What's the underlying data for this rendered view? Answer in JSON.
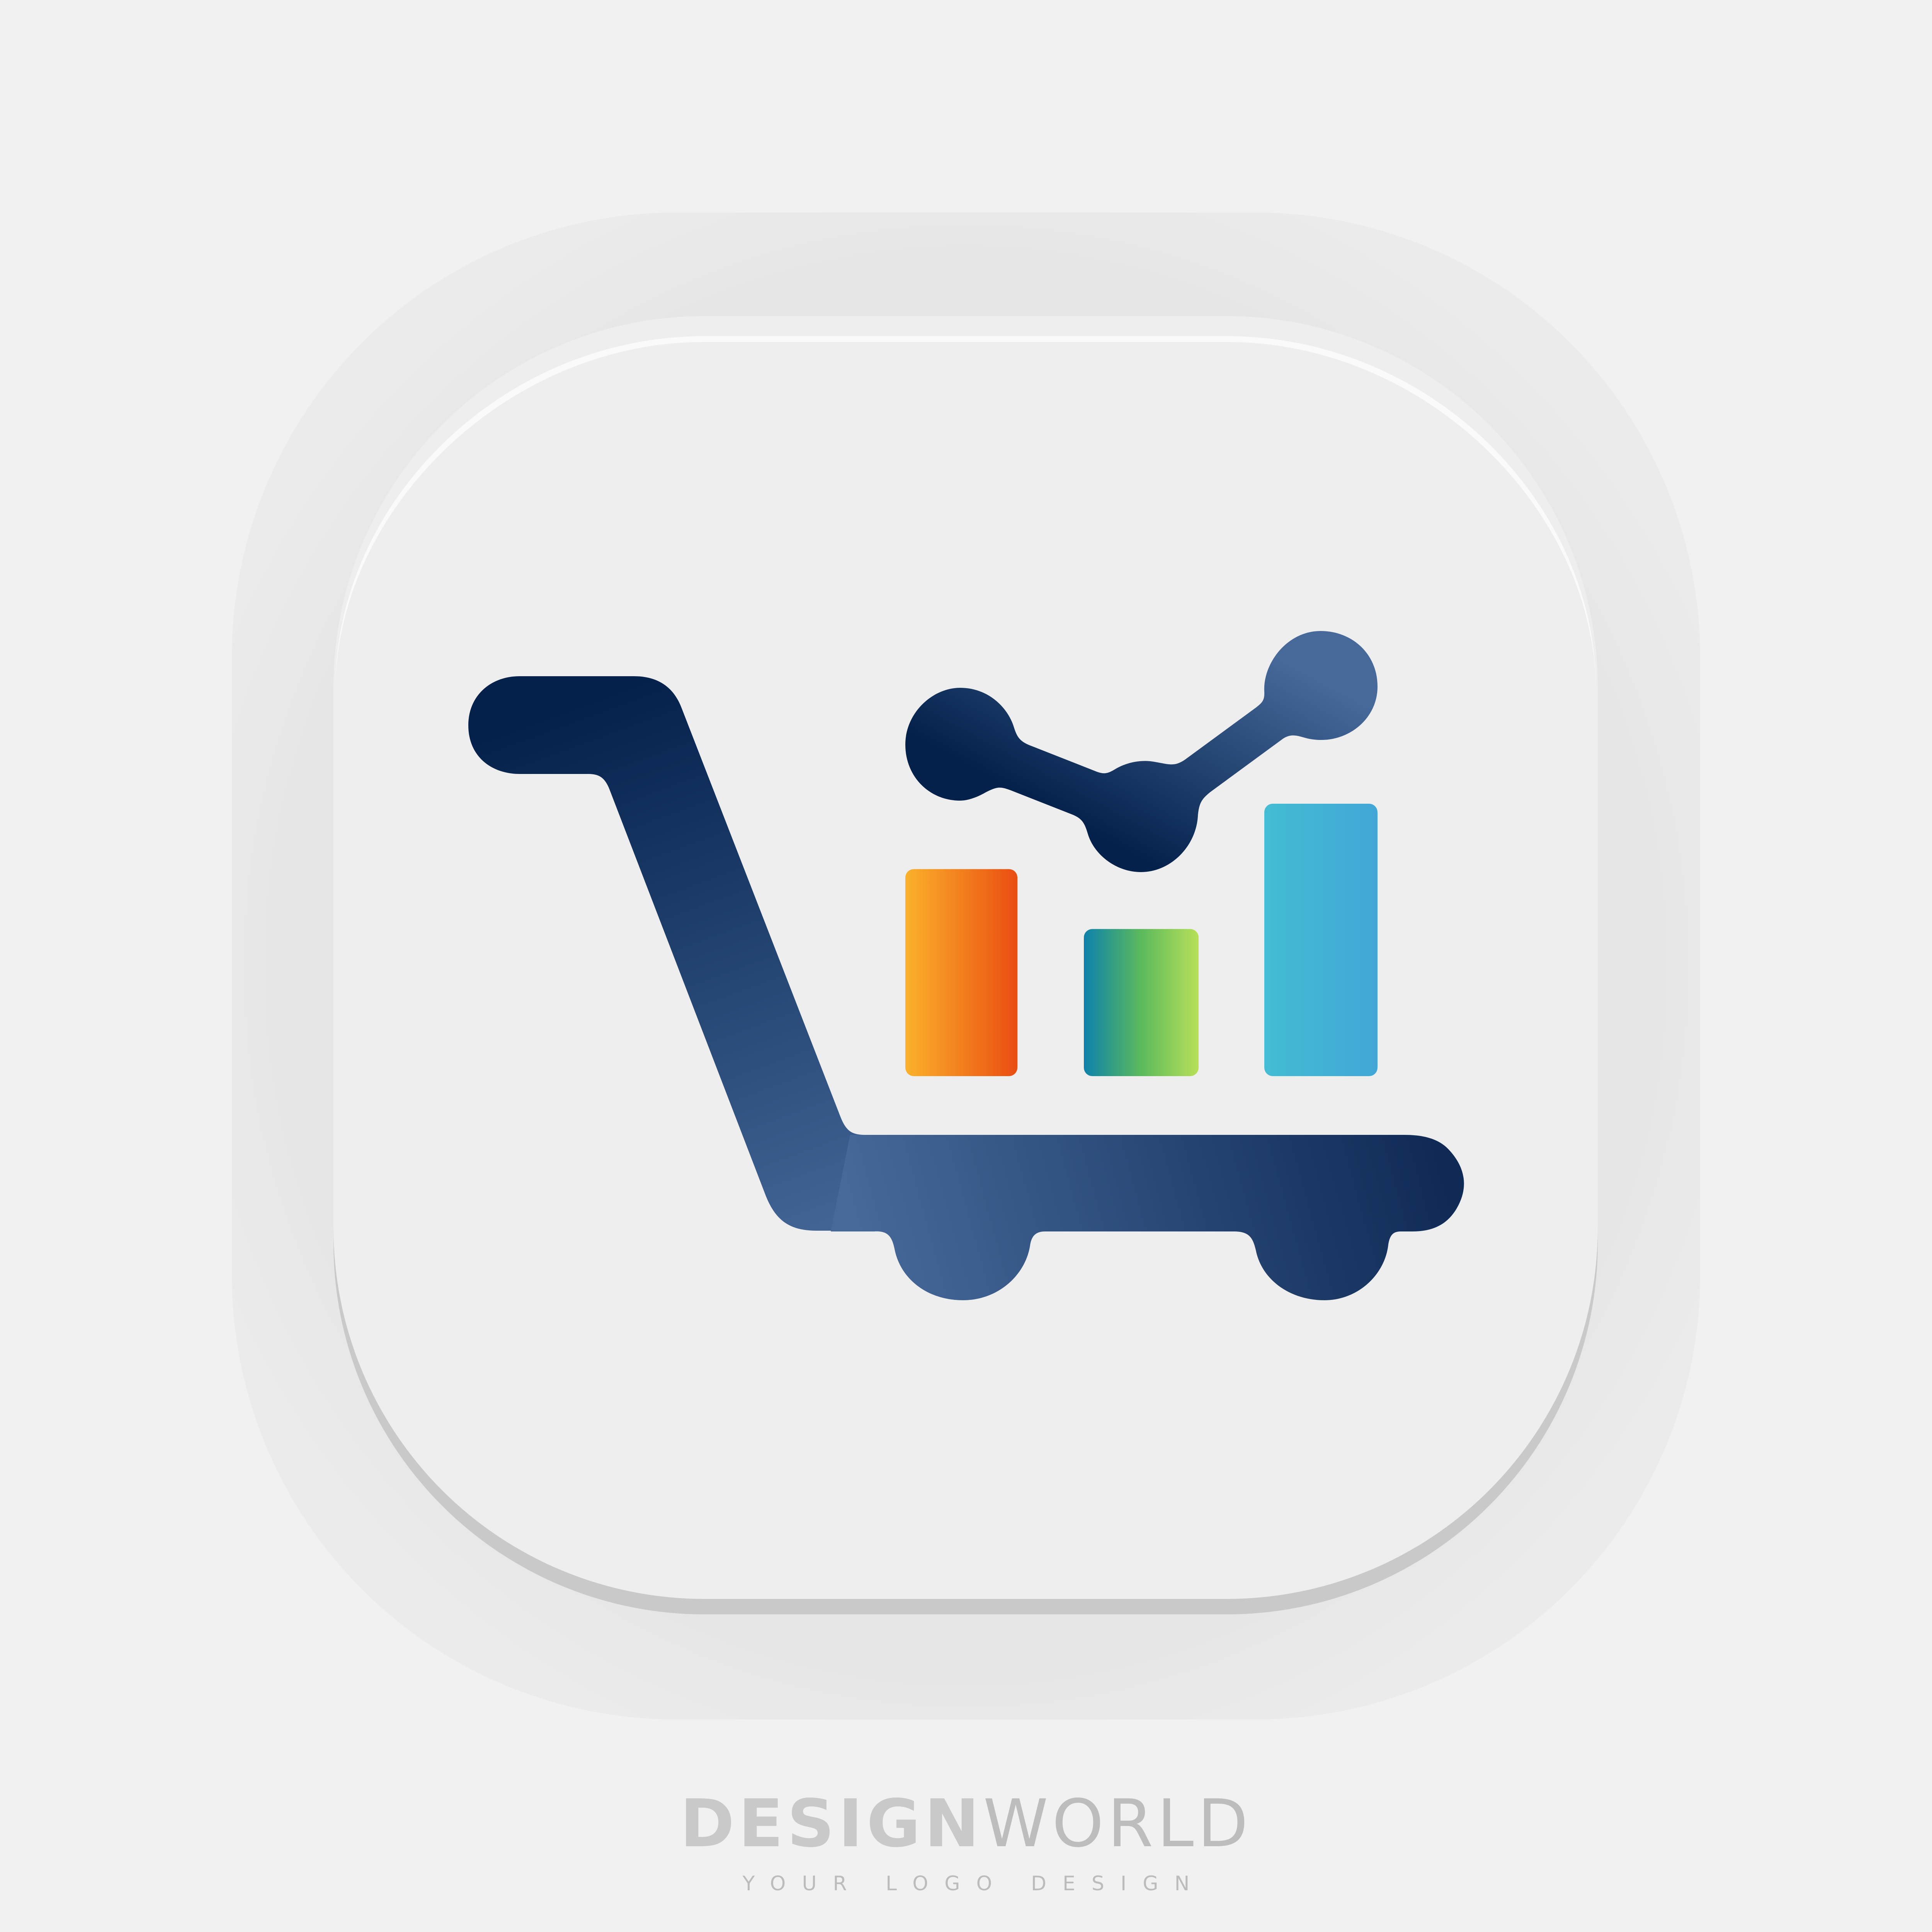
{
  "brand": {
    "name_bold": "DESIGN",
    "name_light": "WORLD",
    "tagline": "YOUR LOGO DESIGN"
  },
  "icon": {
    "name": "shopping-cart-growth-chart-icon",
    "bar_levels": [
      0.76,
      0.54,
      1.0
    ]
  },
  "colors": {
    "background": "#f1f1f1",
    "navy_dark": "#04214b",
    "navy_light": "#46699a",
    "bar1": [
      "#fbb12a",
      "#ea4d12"
    ],
    "bar2": [
      "#0d82ab",
      "#5cba5c",
      "#b7e059"
    ],
    "bar3": [
      "#43bdd4",
      "#42a6d6"
    ]
  }
}
